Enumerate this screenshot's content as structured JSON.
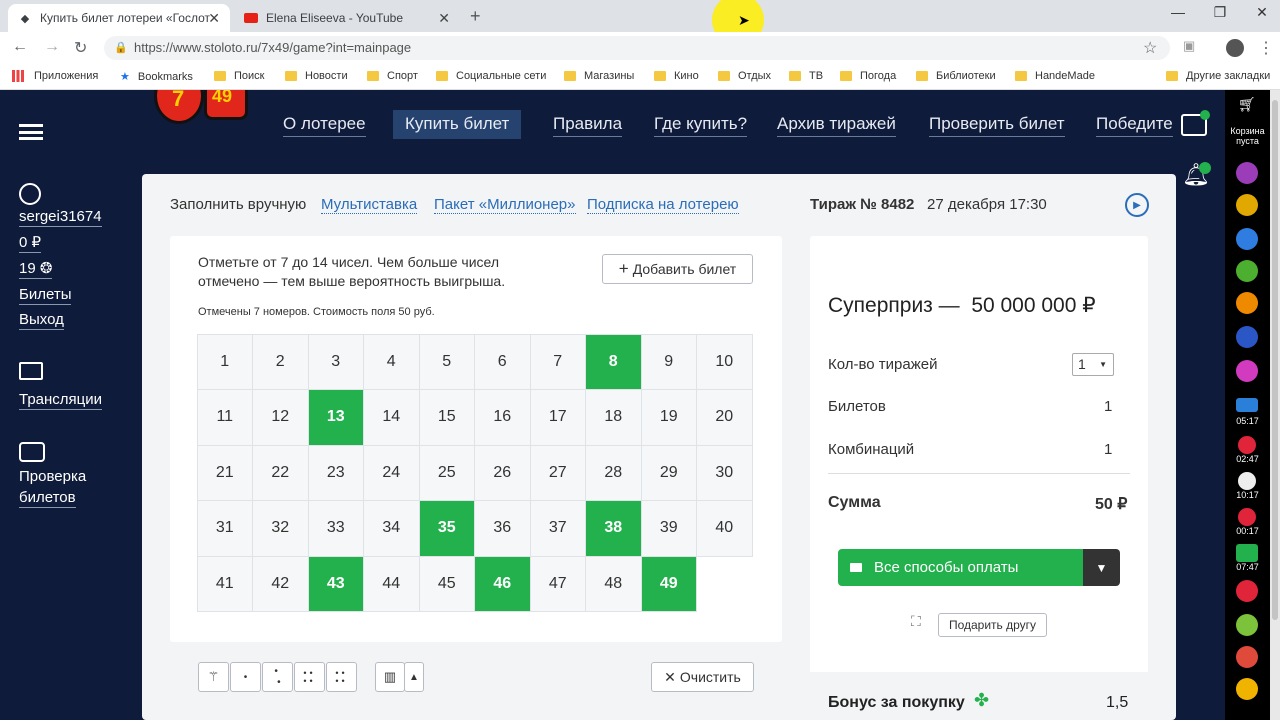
{
  "browser": {
    "tabs": [
      {
        "title": "Купить билет лотереи «Гослото",
        "active": true
      },
      {
        "title": "Elena Eliseeva - YouTube",
        "active": false
      }
    ],
    "url": "https://www.stoloto.ru/7x49/game?int=mainpage",
    "bookmarks": [
      "Приложения",
      "Bookmarks",
      "Поиск",
      "Новости",
      "Спорт",
      "Социальные сети",
      "Магазины",
      "Кино",
      "Отдых",
      "ТВ",
      "Погода",
      "Библиотеки",
      "HandeMade"
    ],
    "other_bookmarks": "Другие закладки"
  },
  "menu": [
    "О лотерее",
    "Купить билет",
    "Правила",
    "Где купить?",
    "Архив тиражей",
    "Проверить билет",
    "Победите"
  ],
  "menu_active": "Купить билет",
  "user": {
    "name": "sergei31674",
    "balance": "0 ₽",
    "bonus": "19",
    "tickets": "Билеты",
    "logout": "Выход",
    "broadcasts": "Трансляции",
    "check1": "Проверка",
    "check2": "билетов"
  },
  "cart": {
    "label1": "Корзина",
    "label2": "пуста"
  },
  "subnav": [
    "Заполнить вручную",
    "Мультиставка",
    "Пакет «Миллионер»",
    "Подписка на лотерею"
  ],
  "draw": {
    "number": "Тираж № 8482",
    "date": "27 декабря 17:30"
  },
  "ticket": {
    "instr1": "Отметьте от 7 до 14 чисел. Чем больше чисел",
    "instr2": "отмечено — тем выше вероятность выигрыша.",
    "add": "Добавить билет",
    "status": "Отмечены 7 номеров. Стоимость поля 50 руб.",
    "selected": [
      8,
      13,
      35,
      38,
      43,
      46,
      49
    ],
    "clear": "Очистить"
  },
  "summary": {
    "superprize_label": "Суперприз —",
    "superprize_value": "50 000 000 ₽",
    "draws_label": "Кол-во тиражей",
    "draws_value": "1",
    "tickets_label": "Билетов",
    "tickets_value": "1",
    "combos_label": "Комбинаций",
    "combos_value": "1",
    "sum_label": "Сумма",
    "sum_value": "50 ₽",
    "pay": "Все способы оплаты",
    "gift": "Подарить другу",
    "bonus_label": "Бонус за покупку",
    "bonus_value": "1,5"
  },
  "strip_times": [
    "05:17",
    "02:47",
    "10:17",
    "00:17",
    "07:47"
  ],
  "colors": {
    "green": "#22b14c",
    "navy": "#0f1b3a",
    "link": "#2a6db8"
  }
}
